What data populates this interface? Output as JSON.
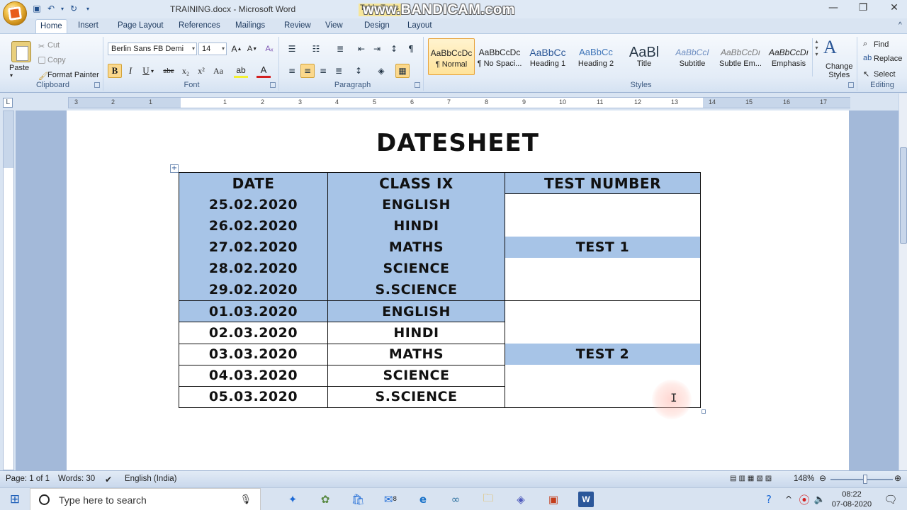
{
  "window": {
    "title": "TRAINING.docx - Microsoft Word",
    "context_tab": "Table Tools",
    "watermark": "www.BANDICAM.com"
  },
  "tabs": [
    "Home",
    "Insert",
    "Page Layout",
    "References",
    "Mailings",
    "Review",
    "View",
    "Design",
    "Layout"
  ],
  "ribbon": {
    "clipboard": {
      "paste": "Paste",
      "cut": "Cut",
      "copy": "Copy",
      "format_painter": "Format Painter",
      "label": "Clipboard"
    },
    "font": {
      "name": "Berlin Sans FB Demi",
      "size": "14",
      "label": "Font",
      "buttons": {
        "bold": "B",
        "italic": "I",
        "underline": "U",
        "strike": "abe",
        "subscript": "x₂",
        "superscript": "x²",
        "change_case": "Aa"
      }
    },
    "paragraph": {
      "label": "Paragraph"
    },
    "styles": {
      "label": "Styles",
      "items": [
        {
          "sample": "AaBbCcDc",
          "name": "¶ Normal"
        },
        {
          "sample": "AaBbCcDc",
          "name": "¶ No Spaci..."
        },
        {
          "sample": "AaBbCc",
          "name": "Heading 1"
        },
        {
          "sample": "AaBbCc",
          "name": "Heading 2"
        },
        {
          "sample": "AaBl",
          "name": "Title"
        },
        {
          "sample": "AaBbCcI",
          "name": "Subtitle"
        },
        {
          "sample": "AaBbCcDı",
          "name": "Subtle Em..."
        },
        {
          "sample": "AaBbCcDı",
          "name": "Emphasis"
        }
      ],
      "change_styles_1": "Change",
      "change_styles_2": "Styles"
    },
    "editing": {
      "find": "Find",
      "replace": "Replace",
      "select": "Select",
      "label": "Editing"
    }
  },
  "document": {
    "title": "DATESHEET",
    "headers": [
      "DATE",
      "CLASS IX",
      "TEST NUMBER"
    ],
    "rows": [
      {
        "date": "25.02.2020",
        "subject": "ENGLISH"
      },
      {
        "date": "26.02.2020",
        "subject": "HINDI"
      },
      {
        "date": "27.02.2020",
        "subject": "MATHS"
      },
      {
        "date": "28.02.2020",
        "subject": "SCIENCE"
      },
      {
        "date": "29.02.2020",
        "subject": "S.SCIENCE"
      },
      {
        "date": "01.03.2020",
        "subject": "ENGLISH"
      },
      {
        "date": "02.03.2020",
        "subject": "HINDI"
      },
      {
        "date": "03.03.2020",
        "subject": "MATHS"
      },
      {
        "date": "04.03.2020",
        "subject": "SCIENCE"
      },
      {
        "date": "05.03.2020",
        "subject": "S.SCIENCE"
      }
    ],
    "tests": [
      "TEST 1",
      "TEST 2"
    ],
    "highlight_color": "#a7c4e7"
  },
  "ruler_numbers": [
    "3",
    "2",
    "1",
    "1",
    "2",
    "3",
    "4",
    "5",
    "6",
    "7",
    "8",
    "9",
    "10",
    "11",
    "12",
    "13",
    "14",
    "15",
    "16",
    "17"
  ],
  "statusbar": {
    "page": "Page: 1 of 1",
    "words": "Words: 30",
    "language": "English (India)",
    "zoom": "148%"
  },
  "taskbar": {
    "search_placeholder": "Type here to search",
    "time": "08:22",
    "date": "07-08-2020",
    "mail_badge": "8"
  }
}
